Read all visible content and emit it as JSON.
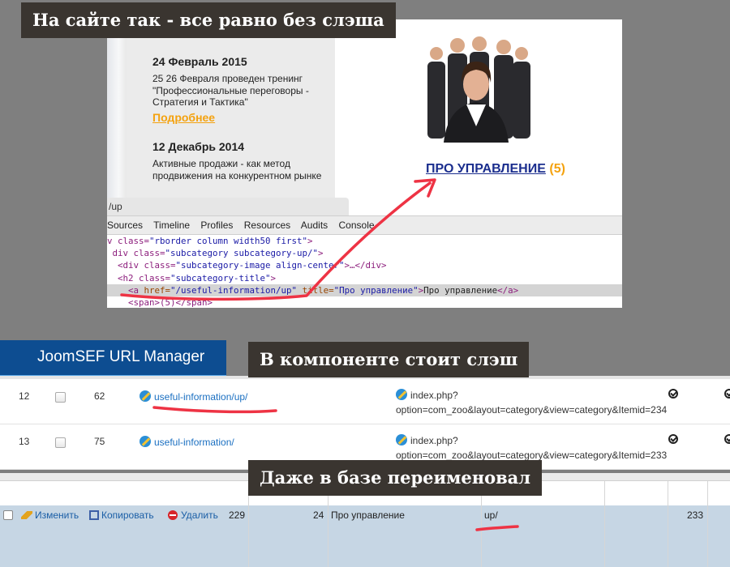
{
  "callouts": {
    "site": "На сайте так - все равно без слэша",
    "component": "В компоненте стоит слэш",
    "database": "Даже в базе переименовал"
  },
  "site": {
    "news": [
      {
        "date": "24 Февраль 2015",
        "text": "25 26 Февраля проведен тренинг \"Профессиональные переговоры - Стратегия и Тактика\"",
        "more": "Подробнее"
      },
      {
        "date": "12 Декабрь 2014",
        "text": "Активные продажи - как метод продвижения на конкурентном рынке"
      }
    ],
    "category_title": "ПРО УПРАВЛЕНИЕ",
    "category_count": "(5)"
  },
  "devtools": {
    "url_fragment": "/up",
    "tabs": [
      "Sources",
      "Timeline",
      "Profiles",
      "Resources",
      "Audits",
      "Console"
    ],
    "lines": {
      "l1_pre": "v class=",
      "l1_val": "\"rborder column width50 first\"",
      "l1_post": ">",
      "l2_pre": "div class=",
      "l2_val": "\"subcategory subcategory-up/\"",
      "l2_post": ">",
      "l3_pre": "<div class=",
      "l3_val": "\"subcategory-image align-center\"",
      "l3_post": ">…</div>",
      "l4_pre": "<h2 class=",
      "l4_val": "\"subcategory-title\"",
      "l4_post": ">",
      "l5_open": "<a ",
      "l5_attr1": "href=",
      "l5_val1": "\"/useful-information/up\"",
      "l5_attr2": " title=",
      "l5_val2": "\"Про управление\"",
      "l5_gt": ">",
      "l5_text": "Про управление",
      "l5_close": "</a>",
      "l6": "<span>(5)</span>"
    }
  },
  "joomsef": {
    "title": "JoomSEF URL Manager",
    "rows": [
      {
        "num": "12",
        "id": "62",
        "sef_url": "useful-information/up/",
        "real_url_1": "index.php?",
        "real_url_2": "option=com_zoo&layout=category&view=category&Itemid=234"
      },
      {
        "num": "13",
        "id": "75",
        "sef_url": "useful-information/",
        "real_url_1": "index.php?",
        "real_url_2": "option=com_zoo&layout=category&view=category&Itemid=233"
      }
    ]
  },
  "db_row": {
    "edit": "Изменить",
    "copy": "Копировать",
    "delete": "Удалить",
    "id": "229",
    "parent": "24",
    "name": "Про управление",
    "alias": "up/",
    "ordering": "233"
  },
  "colors": {
    "callout_bg": "#3a3530",
    "joom_blue": "#0d4d91",
    "link_blue": "#1b2e8e",
    "orange": "#f4a20f",
    "red_mark": "#ee3344",
    "db_row_bg": "#c6d6e4"
  }
}
